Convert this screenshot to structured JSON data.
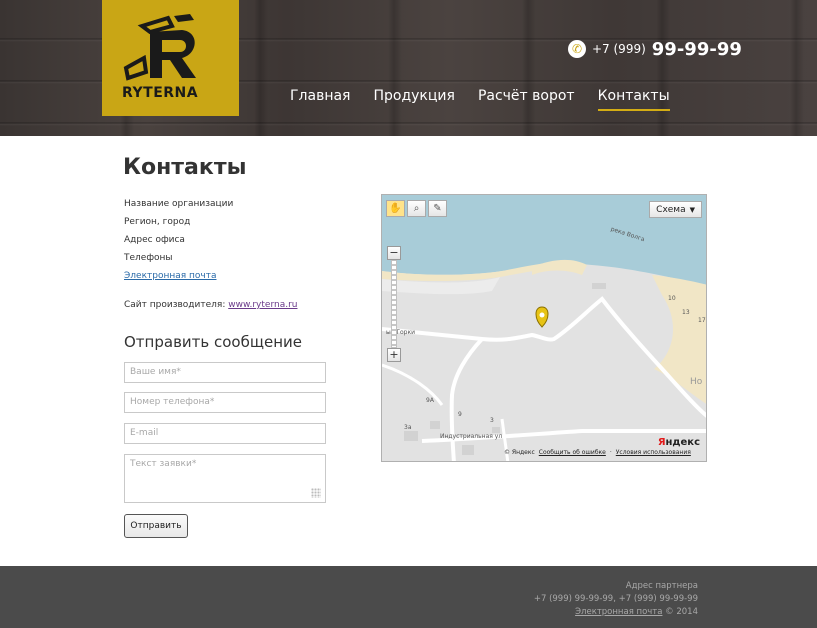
{
  "brand": {
    "logo_text": "RYTERNA",
    "accent": "#c9a615"
  },
  "header": {
    "phone_code": "+7 (999)",
    "phone_number": "99-99-99",
    "nav": [
      {
        "label": "Главная",
        "active": false
      },
      {
        "label": "Продукция",
        "active": false
      },
      {
        "label": "Расчёт ворот",
        "active": false
      },
      {
        "label": "Контакты",
        "active": true
      }
    ]
  },
  "main": {
    "title": "Контакты",
    "info": {
      "org_name": "Название организации",
      "region": "Регион, город",
      "office": "Адрес офиса",
      "phones": "Телефоны",
      "email_link": "Электронная почта"
    },
    "maker_label": "Сайт производителя:",
    "maker_link": "www.ryterna.ru"
  },
  "form": {
    "title": "Отправить сообщение",
    "name_placeholder": "Ваше имя*",
    "phone_placeholder": "Номер телефона*",
    "email_placeholder": "E-mail",
    "message_placeholder": "Текст заявки*",
    "submit_label": "Отправить"
  },
  "map": {
    "scheme_label": "Схема",
    "labels": {
      "river": "река Волга",
      "place1": "ые Горки",
      "street": "Индустриальная ул",
      "edge": "Но",
      "n10": "10",
      "n13": "13",
      "n17": "17",
      "n9a": "9А",
      "n9": "9",
      "n3a": "3а",
      "n3": "3"
    },
    "copyright": "© Яндекс",
    "report_link": "Сообщить об ошибке",
    "terms_link": "Условия использования",
    "logo_y": "Я",
    "logo_rest": "ндекс"
  },
  "footer": {
    "partner_address": "Адрес партнера",
    "phones": "+7 (999) 99-99-99, +7 (999) 99-99-99",
    "email_link": "Электронная почта",
    "copyright": "© 2014"
  }
}
